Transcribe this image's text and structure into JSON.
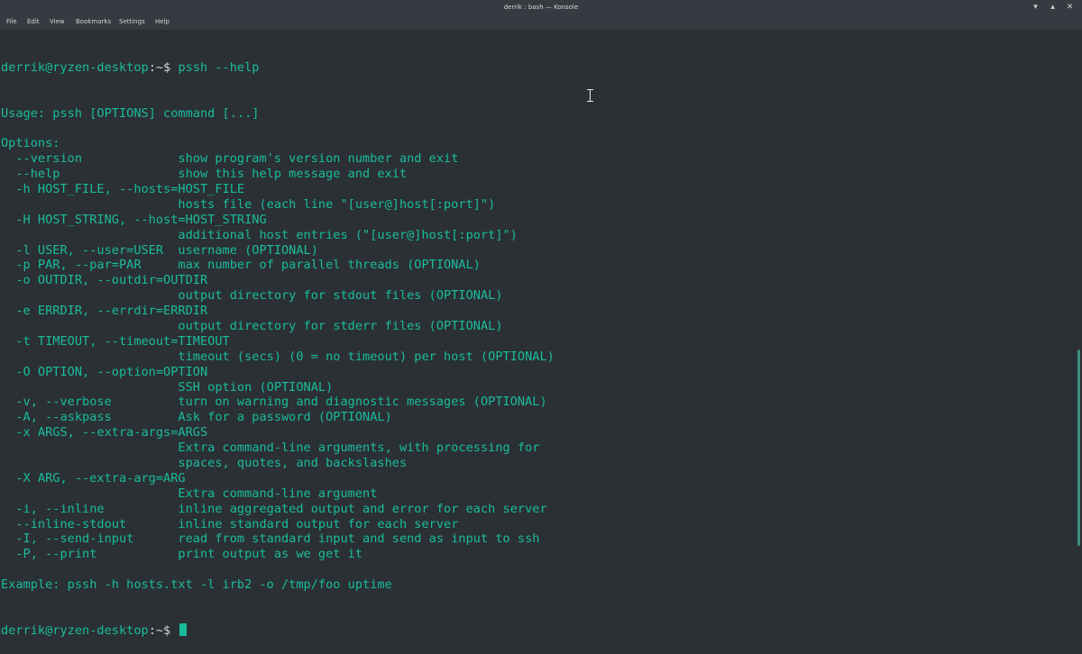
{
  "window": {
    "title": "derrik : bash — Konsole",
    "controls": [
      "▾",
      "▴",
      "✕"
    ]
  },
  "menu": [
    "File",
    "Edit",
    "View",
    "Bookmarks",
    "Settings",
    "Help"
  ],
  "terminal": {
    "prompt_user": "derrik@ryzen-desktop",
    "prompt_path": ":~$",
    "command": "pssh --help",
    "output": [
      "Usage: pssh [OPTIONS] command [...]",
      "",
      "Options:",
      "  --version             show program's version number and exit",
      "  --help                show this help message and exit",
      "  -h HOST_FILE, --hosts=HOST_FILE",
      "                        hosts file (each line \"[user@]host[:port]\")",
      "  -H HOST_STRING, --host=HOST_STRING",
      "                        additional host entries (\"[user@]host[:port]\")",
      "  -l USER, --user=USER  username (OPTIONAL)",
      "  -p PAR, --par=PAR     max number of parallel threads (OPTIONAL)",
      "  -o OUTDIR, --outdir=OUTDIR",
      "                        output directory for stdout files (OPTIONAL)",
      "  -e ERRDIR, --errdir=ERRDIR",
      "                        output directory for stderr files (OPTIONAL)",
      "  -t TIMEOUT, --timeout=TIMEOUT",
      "                        timeout (secs) (0 = no timeout) per host (OPTIONAL)",
      "  -O OPTION, --option=OPTION",
      "                        SSH option (OPTIONAL)",
      "  -v, --verbose         turn on warning and diagnostic messages (OPTIONAL)",
      "  -A, --askpass         Ask for a password (OPTIONAL)",
      "  -x ARGS, --extra-args=ARGS",
      "                        Extra command-line arguments, with processing for",
      "                        spaces, quotes, and backslashes",
      "  -X ARG, --extra-arg=ARG",
      "                        Extra command-line argument",
      "  -i, --inline          inline aggregated output and error for each server",
      "  --inline-stdout       inline standard output for each server",
      "  -I, --send-input      read from standard input and send as input to ssh",
      "  -P, --print           print output as we get it",
      "",
      "Example: pssh -h hosts.txt -l irb2 -o /tmp/foo uptime"
    ]
  },
  "colors": {
    "background": "#2b3035",
    "text": "#1abc9c",
    "chrome": "#353b41"
  }
}
